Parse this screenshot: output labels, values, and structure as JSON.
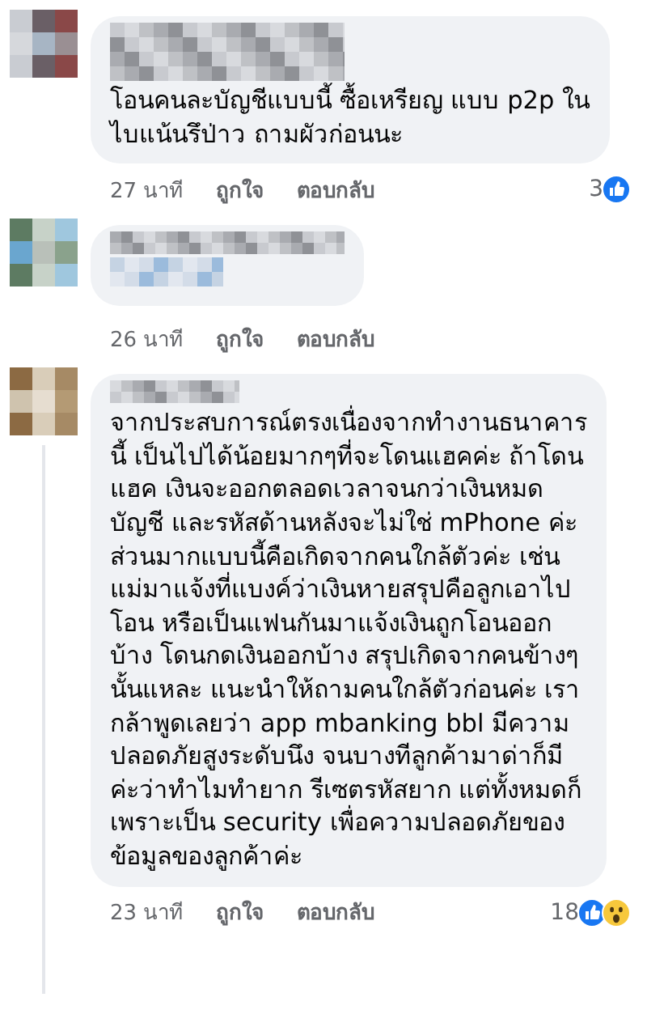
{
  "comments": [
    {
      "kind": "text",
      "text": "โอนคนละบัญชีแบบนี้ ซื้อเหรียญ แบบ p2p ใน\nไบแน้นรึป่าว ถามผัวก่อนนะ",
      "time": "27 นาที",
      "like_label": "ถูกใจ",
      "reply_label": "ตอบกลับ",
      "reactions": {
        "count": "3",
        "icons": [
          {
            "kind": "like"
          }
        ]
      }
    },
    {
      "kind": "blurred",
      "time": "26 นาที",
      "like_label": "ถูกใจ",
      "reply_label": "ตอบกลับ"
    },
    {
      "kind": "text",
      "text": "จากประสบการณ์ตรงเนื่องจากทำงานธนาคาร\nนี้ เป็นไปได้น้อยมากๆที่จะโดนแฮคค่ะ ถ้าโดน\nแฮค เงินจะออกตลอดเวลาจนกว่าเงินหมด\nบัญชี และรหัสด้านหลังจะไม่ใช่ mPhone ค่ะ\nส่วนมากแบบนี้คือเกิดจากคนใกล้ตัวค่ะ เช่น\nแม่มาแจ้งที่แบงค์ว่าเงินหายสรุปคือลูกเอาไป\nโอน หรือเป็นแฟนกันมาแจ้งเงินถูกโอนออก\nบ้าง โดนกดเงินออกบ้าง สรุปเกิดจากคนข้างๆ\nนั้นแหละ แนะนำให้ถามคนใกล้ตัวก่อนค่ะ เรา\nกล้าพูดเลยว่า app mbanking bbl มีความ\nปลอดภัยสูงระดับนึง จนบางทีลูกค้ามาด่าก็มี\nค่ะว่าทำไมทำยาก รีเซตรหัสยาก แต่ทั้งหมดก็\nเพราะเป็น security เพื่อความปลอดภัยของ\nข้อมูลของลูกค้าค่ะ",
      "time": "23 นาที",
      "like_label": "ถูกใจ",
      "reply_label": "ตอบกลับ",
      "reactions": {
        "count": "18",
        "icons": [
          {
            "kind": "like"
          },
          {
            "kind": "wow"
          }
        ]
      }
    }
  ]
}
